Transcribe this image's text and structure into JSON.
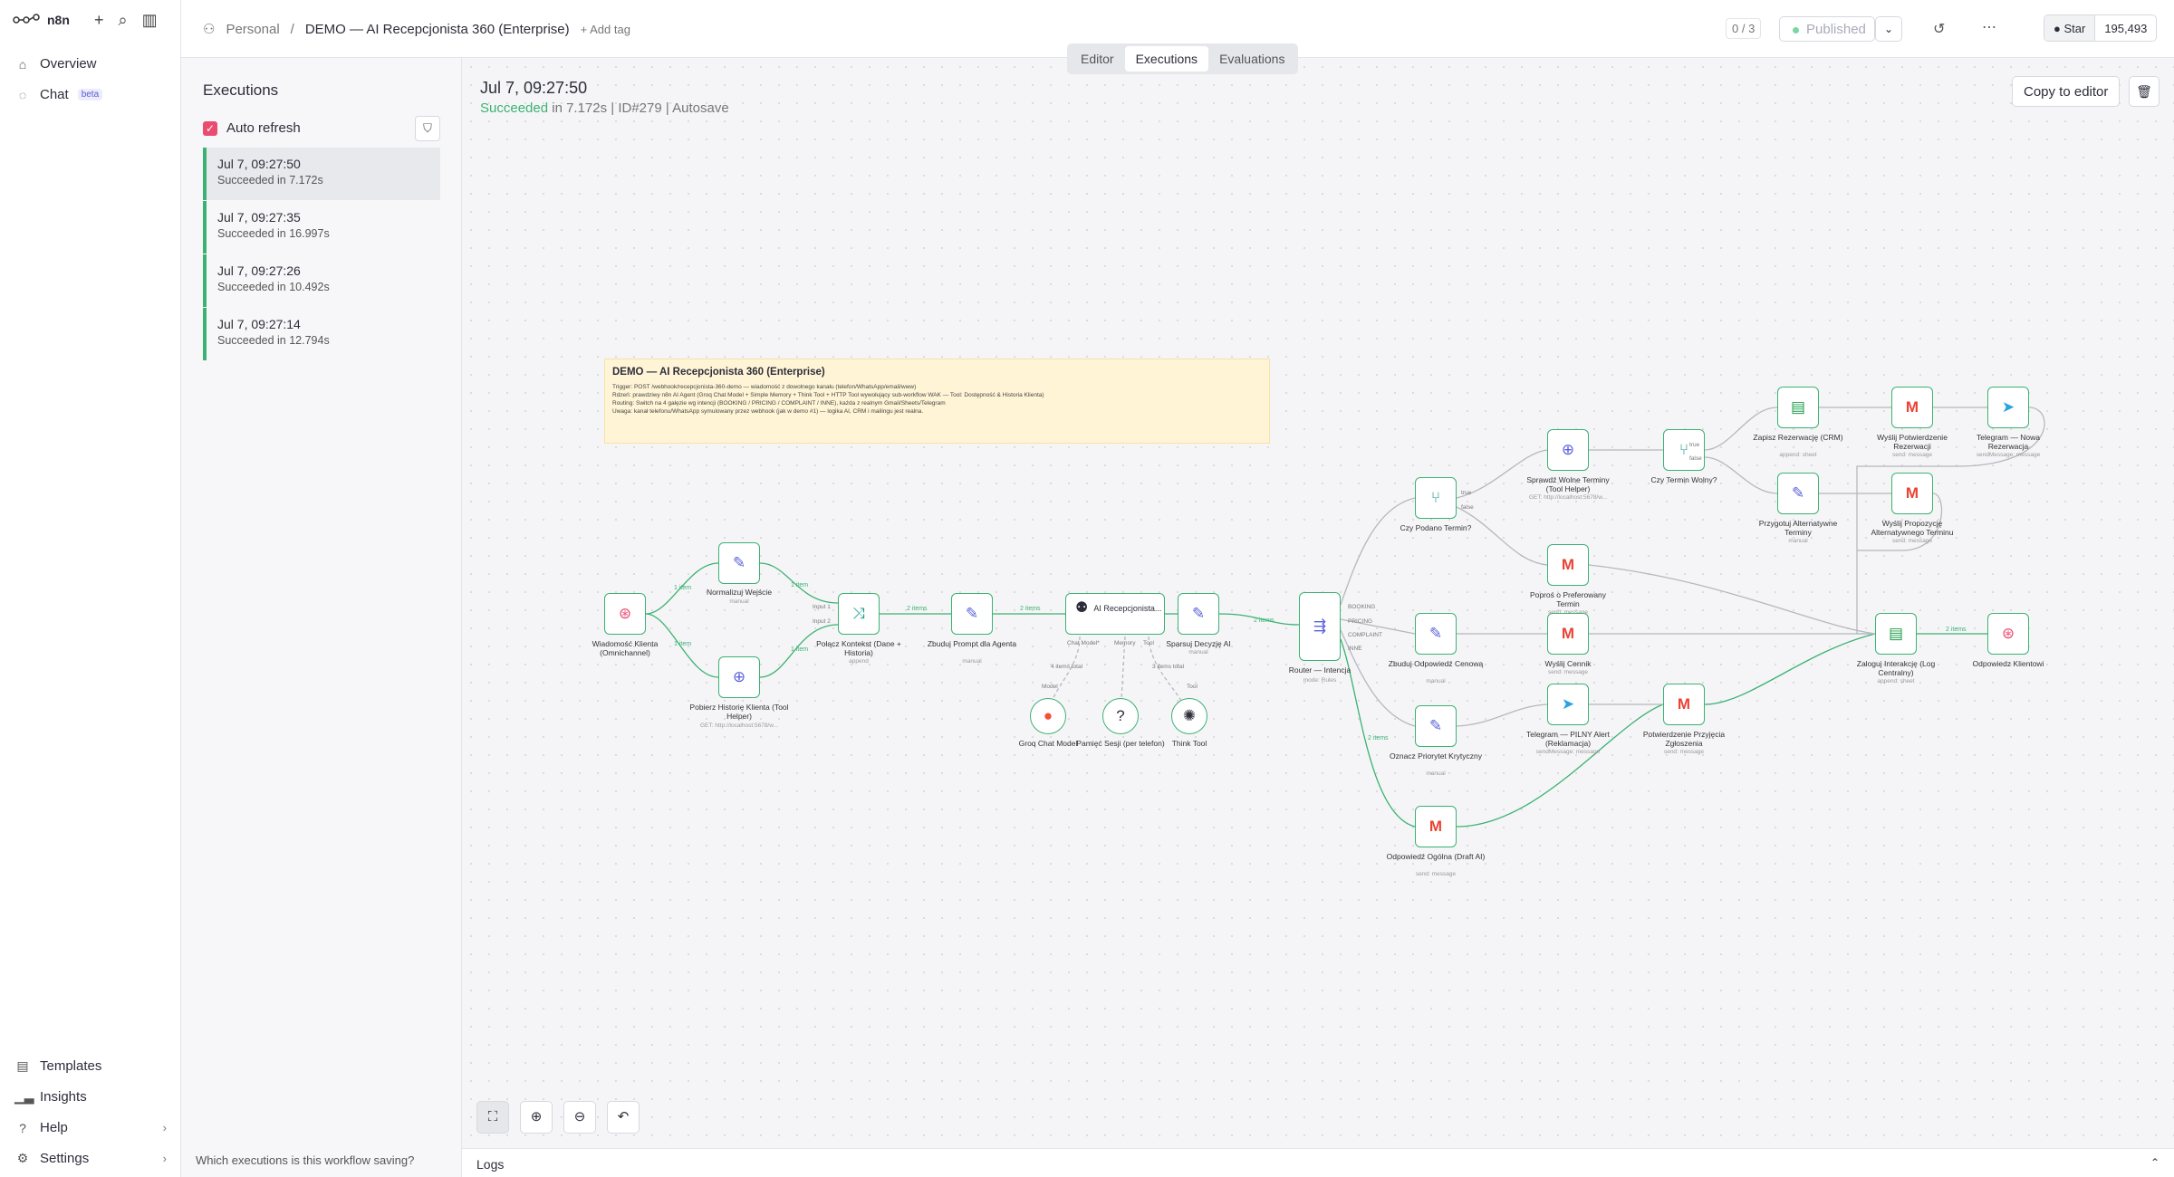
{
  "app": {
    "name": "n8n"
  },
  "sidebar": {
    "items": [
      {
        "label": "Overview",
        "icon": "home-icon"
      },
      {
        "label": "Chat",
        "badge": "beta",
        "icon": "chat-icon"
      }
    ],
    "bottom": [
      {
        "label": "Templates",
        "icon": "templates-icon"
      },
      {
        "label": "Insights",
        "icon": "insights-icon"
      },
      {
        "label": "Help",
        "icon": "help-icon"
      },
      {
        "label": "Settings",
        "icon": "gear-icon"
      }
    ]
  },
  "header": {
    "project": "Personal",
    "workflow": "DEMO — AI Recepcjonista 360 (Enterprise)",
    "add_tag": "+ Add tag",
    "counter": "0 / 3",
    "status": "Published",
    "github_label": "Star",
    "github_count": "195,493",
    "tabs": [
      "Editor",
      "Executions",
      "Evaluations"
    ]
  },
  "executions": {
    "title": "Executions",
    "auto_refresh": "Auto refresh",
    "items": [
      {
        "time": "Jul 7, 09:27:50",
        "status": "Succeeded in 7.172s"
      },
      {
        "time": "Jul 7, 09:27:35",
        "status": "Succeeded in 16.997s"
      },
      {
        "time": "Jul 7, 09:27:26",
        "status": "Succeeded in 10.492s"
      },
      {
        "time": "Jul 7, 09:27:14",
        "status": "Succeeded in 12.794s"
      }
    ],
    "which_saving": "Which executions is this workflow saving?"
  },
  "detail": {
    "date": "Jul 7, 09:27:50",
    "status_word": "Succeeded",
    "status_rest": " in 7.172s | ID#279 | Autosave",
    "copy_button": "Copy to editor"
  },
  "note": {
    "title": "DEMO — AI Recepcjonista 360 (Enterprise)",
    "lines": [
      "Trigger: POST /webhook/recepcjonista-360-demo — wiadomość z dowolnego kanału (telefon/WhatsApp/email/www)",
      "Rdzeń: prawdziwy n8n AI Agent (Groq Chat Model + Simple Memory + Think Tool + HTTP Tool wywołujący sub-workflow WAK — Tool: Dostępność & Historia Klienta)",
      "Routing: Switch na 4 gałęzie wg intencji (BOOKING / PRICING / COMPLAINT / INNE), każda z realnym Gmail/Sheets/Telegram",
      "Uwaga: kanał telefonu/WhatsApp symulowany przez webhook (jak w demo #1) — logika AI, CRM i mailingu jest realna."
    ]
  },
  "nodes": {
    "webhook": {
      "label": "Wiadomość Klienta (Omnichannel)"
    },
    "normalize": {
      "label": "Normalizuj Wejście",
      "sub": "manual"
    },
    "history": {
      "label": "Pobierz Historię Klienta (Tool Helper)",
      "sub": "GET: http://localhost:5678/w..."
    },
    "merge": {
      "label": "Połącz Kontekst (Dane + Historia)",
      "sub": "append"
    },
    "prompt": {
      "label": "Zbuduj Prompt dla Agenta",
      "sub": "manual"
    },
    "agent": {
      "label": "AI Recepcjonista..."
    },
    "parse": {
      "label": "Sparsuj Decyzję AI",
      "sub": "manual"
    },
    "router": {
      "label": "Router — Intencja",
      "sub": "mode: Rules"
    },
    "groq": {
      "label": "Groq Chat Model"
    },
    "memory": {
      "label": "Pamięć Sesji (per telefon)"
    },
    "think": {
      "label": "Think Tool"
    },
    "if_term": {
      "label": "Czy Podano Termin?"
    },
    "check_slots": {
      "label": "Sprawdź Wolne Terminy (Tool Helper)",
      "sub": "GET: http://localhost:5678/w..."
    },
    "if_free": {
      "label": "Czy Termin Wolny?"
    },
    "save_res": {
      "label": "Zapisz Rezerwację (CRM)",
      "sub": "append: sheet"
    },
    "send_confirm": {
      "label": "Wyślij Potwierdzenie Rezerwacji",
      "sub": "send: message"
    },
    "tg_new": {
      "label": "Telegram — Nowa Rezerwacja",
      "sub": "sendMessage: message"
    },
    "prep_alt": {
      "label": "Przygotuj Alternatywne Terminy",
      "sub": "manual"
    },
    "send_alt": {
      "label": "Wyślij Propozycję Alternatywnego Terminu",
      "sub": "send: message"
    },
    "ask_pref": {
      "label": "Poproś o Preferowany Termin",
      "sub": "send: message"
    },
    "build_price": {
      "label": "Zbuduj Odpowiedź Cenową",
      "sub": "manual"
    },
    "send_price": {
      "label": "Wyślij Cennik",
      "sub": "send: message"
    },
    "mark_prio": {
      "label": "Oznacz Priorytet Krytyczny",
      "sub": "manual"
    },
    "tg_alert": {
      "label": "Telegram — PILNY Alert (Reklamacja)",
      "sub": "sendMessage: message"
    },
    "confirm_report": {
      "label": "Potwierdzenie Przyjęcia Zgłoszenia",
      "sub": "send: message"
    },
    "general": {
      "label": "Odpowiedź Ogólna (Draft AI)",
      "sub": "send: message"
    },
    "log": {
      "label": "Zaloguj Interakcję (Log Centralny)",
      "sub": "append: sheet"
    },
    "respond": {
      "label": "Odpowiedz Klientowi"
    }
  },
  "edge_labels": {
    "one_item": "1 item",
    "two_items": "2 items",
    "true": "true",
    "false": "false",
    "booking": "BOOKING",
    "pricing": "PRICING",
    "complaint": "COMPLAINT",
    "inne": "INNE",
    "input1": "Input 1",
    "input2": "Input 2",
    "chat_model": "Chat Model*",
    "memory": "Memory",
    "tool": "Tool",
    "model": "Model",
    "four_items": "4 items total",
    "three_items": "3 items total"
  },
  "logs": {
    "label": "Logs"
  },
  "colors": {
    "success": "#3bb273",
    "accent": "#ea4b71",
    "note": "#fff5d6"
  }
}
